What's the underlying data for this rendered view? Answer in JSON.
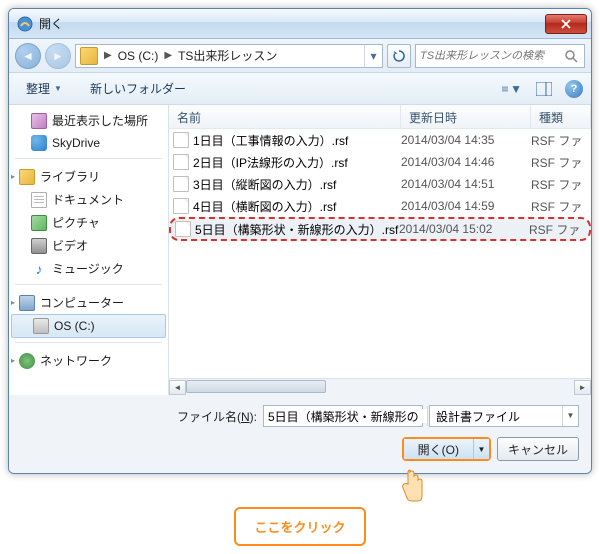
{
  "title": "開く",
  "breadcrumb": {
    "drive": "OS (C:)",
    "folder": "TS出来形レッスン"
  },
  "search_placeholder": "TS出来形レッスンの検索",
  "toolbar": {
    "organize": "整理",
    "new_folder": "新しいフォルダー"
  },
  "tree": {
    "recent": "最近表示した場所",
    "skydrive": "SkyDrive",
    "libraries": "ライブラリ",
    "documents": "ドキュメント",
    "pictures": "ピクチャ",
    "videos": "ビデオ",
    "music": "ミュージック",
    "computer": "コンピューター",
    "drive": "OS (C:)",
    "network": "ネットワーク"
  },
  "columns": {
    "name": "名前",
    "date": "更新日時",
    "type": "種類"
  },
  "files": [
    {
      "name": "1日目（工事情報の入力）.rsf",
      "date": "2014/03/04 14:35",
      "type": "RSF ファ"
    },
    {
      "name": "2日目（IP法線形の入力）.rsf",
      "date": "2014/03/04 14:46",
      "type": "RSF ファ"
    },
    {
      "name": "3日目（縦断図の入力）.rsf",
      "date": "2014/03/04 14:51",
      "type": "RSF ファ"
    },
    {
      "name": "4日目（横断図の入力）.rsf",
      "date": "2014/03/04 14:59",
      "type": "RSF ファ"
    },
    {
      "name": "5日目（構築形状・新線形の入力）.rsf",
      "date": "2014/03/04 15:02",
      "type": "RSF ファ"
    }
  ],
  "filename_label_pre": "ファイル名(",
  "filename_label_key": "N",
  "filename_label_post": "):",
  "filename_value": "5日目（構築形状・新線形の",
  "filter": "設計書ファイル",
  "open_btn": "開く(O)",
  "cancel_btn": "キャンセル",
  "callout": "ここをクリック"
}
